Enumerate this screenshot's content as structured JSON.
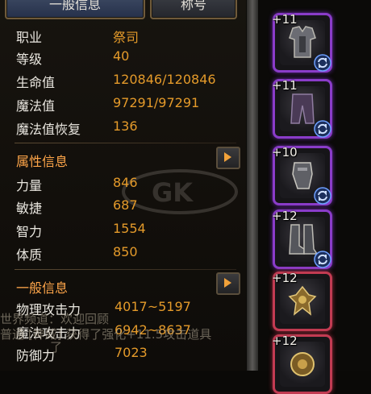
{
  "tabs": {
    "general": "一般信息",
    "title": "称号"
  },
  "basic": [
    {
      "label": "职业",
      "value": "祭司"
    },
    {
      "label": "等级",
      "value": "40"
    },
    {
      "label": "生命值",
      "value": "120846/120846"
    },
    {
      "label": "魔法值",
      "value": "97291/97291"
    },
    {
      "label": "魔法值恢复",
      "value": "136"
    }
  ],
  "attributes": {
    "title": "属性信息",
    "rows": [
      {
        "label": "力量",
        "value": "846"
      },
      {
        "label": "敏捷",
        "value": "687"
      },
      {
        "label": "智力",
        "value": "1554"
      },
      {
        "label": "体质",
        "value": "850"
      }
    ]
  },
  "general": {
    "title": "一般信息",
    "rows": [
      {
        "label": "物理攻击力",
        "value": "4017~5197"
      },
      {
        "label": "魔法攻击力",
        "value": "6942~8637"
      },
      {
        "label": "防御力",
        "value": "7023"
      }
    ]
  },
  "chat_overlay": {
    "line1": "世界频道：欢迎回顾",
    "line2": "普通 [神威] 获得了强化+11.5攻击道具",
    "line3": "了"
  },
  "watermark_text": "GK",
  "equipment": [
    {
      "plus": "+11",
      "rarity": "purple",
      "icon": "armor-chest-icon"
    },
    {
      "plus": "+11",
      "rarity": "purple",
      "icon": "pants-icon"
    },
    {
      "plus": "+10",
      "rarity": "purple",
      "icon": "gauntlet-icon"
    },
    {
      "plus": "+12",
      "rarity": "purple",
      "icon": "boots-icon"
    },
    {
      "plus": "+12",
      "rarity": "red",
      "icon": "accessory-icon"
    },
    {
      "plus": "+12",
      "rarity": "red",
      "icon": "amulet-icon"
    }
  ],
  "colors": {
    "value": "#e49a2a",
    "section": "#ffa64a",
    "purple": "#8a3cc9",
    "red": "#c23b52"
  }
}
